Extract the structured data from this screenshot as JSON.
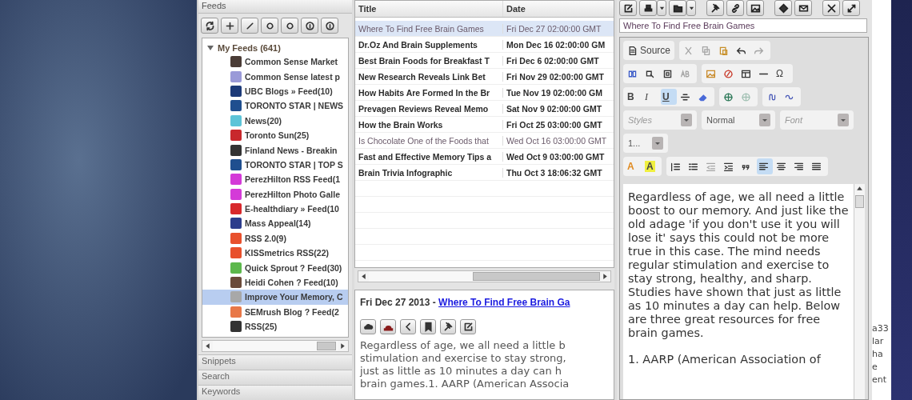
{
  "feeds_panel": {
    "title": "Feeds",
    "tree": [
      {
        "label": "My Feeds (641)",
        "expanded": true,
        "children": [
          {
            "label": "Common Sense Market",
            "color": "#4a3c36",
            "selected": false
          },
          {
            "label": "Common Sense latest p",
            "color": "#9a9ad8",
            "selected": false
          },
          {
            "label": "UBC Blogs » Feed(10)",
            "color": "#1c3a78",
            "selected": false
          },
          {
            "label": "TORONTO STAR | NEWS",
            "color": "#1f4f8f",
            "selected": false
          },
          {
            "label": "News(20)",
            "color": "#5cc4d8",
            "selected": false
          },
          {
            "label": "Toronto Sun(25)",
            "color": "#c8282c",
            "selected": false
          },
          {
            "label": "Finland News - Breakin",
            "color": "#333333",
            "selected": false
          },
          {
            "label": "TORONTO STAR | TOP S",
            "color": "#1f4f8f",
            "selected": false
          },
          {
            "label": "PerezHilton RSS Feed(1",
            "color": "#d43ad8",
            "selected": false
          },
          {
            "label": "PerezHilton Photo Galle",
            "color": "#d43ad8",
            "selected": false
          },
          {
            "label": "E-healthdiary » Feed(10",
            "color": "#d8282c",
            "selected": false
          },
          {
            "label": "Mass Appeal(14)",
            "color": "#2c3c8c",
            "selected": false
          },
          {
            "label": "RSS 2.0(9)",
            "color": "#e8502c",
            "selected": false
          },
          {
            "label": "KISSmetrics RSS(22)",
            "color": "#e8502c",
            "selected": false
          },
          {
            "label": "Quick Sprout ? Feed(30)",
            "color": "#5cb84c",
            "selected": false
          },
          {
            "label": "Heidi Cohen ? Feed(10)",
            "color": "#6a4a3a",
            "selected": false
          },
          {
            "label": "Improve Your Memory, C",
            "color": "#a8a8a8",
            "selected": true
          },
          {
            "label": "SEMrush Blog ? Feed(2",
            "color": "#e87848",
            "selected": false
          },
          {
            "label": "RSS(25)",
            "color": "#333333",
            "selected": false
          }
        ]
      }
    ],
    "sections": [
      "Snippets",
      "Search",
      "Keywords"
    ]
  },
  "articles": {
    "columns": [
      "Title",
      "Date"
    ],
    "rows": [
      {
        "title": "Where To Find Free Brain Games",
        "date": "Fri Dec 27 02:00:00 GMT",
        "unread": false,
        "selected": true
      },
      {
        "title": "Dr.Oz And Brain Supplements",
        "date": "Mon Dec 16 02:00:00 GM",
        "unread": true,
        "selected": false
      },
      {
        "title": "Best Brain Foods for Breakfast T",
        "date": "Fri Dec 6 02:00:00 GMT",
        "unread": true,
        "selected": false
      },
      {
        "title": "New Research Reveals Link Bet",
        "date": "Fri Nov 29 02:00:00 GMT",
        "unread": true,
        "selected": false
      },
      {
        "title": "How Habits Are Formed In the Br",
        "date": "Tue Nov 19 02:00:00 GM",
        "unread": true,
        "selected": false
      },
      {
        "title": "Prevagen Reviews Reveal Memo",
        "date": "Sat Nov 9 02:00:00 GMT",
        "unread": true,
        "selected": false
      },
      {
        "title": "How the Brain Works",
        "date": "Fri Oct 25 03:00:00 GMT",
        "unread": true,
        "selected": false
      },
      {
        "title": "Is Chocolate One of the Foods that",
        "date": "Wed Oct 16 03:00:00 GMT",
        "unread": false,
        "selected": false
      },
      {
        "title": "Fast and Effective Memory Tips a",
        "date": "Wed Oct 9 03:00:00 GMT",
        "unread": true,
        "selected": false
      },
      {
        "title": "Brain Trivia Infographic",
        "date": "Thu Oct 3 18:06:32 GMT",
        "unread": true,
        "selected": false
      }
    ]
  },
  "preview": {
    "date": "Fri Dec 27 2013 - ",
    "link": "Where To Find Free Brain Ga",
    "lines": [
      "Regardless of age, we all need a little b",
      "stimulation and exercise to stay strong,",
      "just as little as 10 minutes a day can h",
      "brain games.1. AARP (American Associa"
    ]
  },
  "composer": {
    "subject": "Where To Find Free Brain Games",
    "editor_toolbar": [
      [
        [
          {
            "kind": "button",
            "label": "Source",
            "on": false,
            "disabled": false
          }
        ],
        [
          {
            "kind": "button",
            "on": false,
            "disabled": true
          },
          {
            "kind": "button",
            "on": false,
            "disabled": true
          },
          {
            "kind": "button",
            "on": false,
            "disabled": false
          },
          {
            "kind": "button",
            "on": false,
            "disabled": false
          },
          {
            "kind": "button",
            "on": false,
            "disabled": true
          }
        ]
      ],
      [
        [
          {
            "kind": "button",
            "on": false,
            "disabled": false
          },
          {
            "kind": "button",
            "on": false,
            "disabled": false
          },
          {
            "kind": "button",
            "on": false,
            "disabled": false
          },
          {
            "kind": "button",
            "on": false,
            "disabled": true
          }
        ],
        [
          {
            "kind": "button",
            "on": false,
            "disabled": false
          },
          {
            "kind": "button",
            "on": false,
            "disabled": false
          },
          {
            "kind": "button",
            "on": false,
            "disabled": false
          },
          {
            "kind": "button",
            "on": false,
            "disabled": false
          },
          {
            "kind": "button",
            "label": "Ω",
            "on": false,
            "disabled": false
          }
        ]
      ],
      [
        [
          {
            "kind": "button",
            "label": "B",
            "on": false,
            "disabled": false
          },
          {
            "kind": "button",
            "label": "I",
            "on": false,
            "disabled": false
          },
          {
            "kind": "button",
            "label": "U",
            "on": true,
            "disabled": false
          },
          {
            "kind": "button",
            "on": false,
            "disabled": false
          },
          {
            "kind": "button",
            "on": false,
            "disabled": false
          }
        ],
        [
          {
            "kind": "button",
            "on": false,
            "disabled": false
          },
          {
            "kind": "button",
            "on": false,
            "disabled": true
          }
        ],
        [
          {
            "kind": "button",
            "on": false,
            "disabled": false
          },
          {
            "kind": "button",
            "on": false,
            "disabled": false
          }
        ]
      ],
      [
        [
          {
            "kind": "combo",
            "placeholder": "Styles"
          }
        ],
        [
          {
            "kind": "combo",
            "value": "Normal"
          }
        ],
        [
          {
            "kind": "combo",
            "placeholder": "Font"
          }
        ]
      ],
      [
        [
          {
            "kind": "combo",
            "value": "1..."
          }
        ]
      ],
      [
        [
          {
            "kind": "button",
            "label": "A",
            "on": false,
            "disabled": false
          },
          {
            "kind": "button",
            "label": "A",
            "on": false,
            "disabled": false
          }
        ],
        [
          {
            "kind": "button",
            "on": false,
            "disabled": false
          },
          {
            "kind": "button",
            "on": false,
            "disabled": false
          },
          {
            "kind": "button",
            "on": false,
            "disabled": true
          },
          {
            "kind": "button",
            "on": false,
            "disabled": false
          },
          {
            "kind": "button",
            "on": false,
            "disabled": false
          },
          {
            "kind": "button",
            "on": true,
            "disabled": false
          },
          {
            "kind": "button",
            "on": false,
            "disabled": false
          },
          {
            "kind": "button",
            "on": false,
            "disabled": false
          },
          {
            "kind": "button",
            "on": false,
            "disabled": false
          }
        ]
      ]
    ],
    "body": [
      "Regardless of age, we all need a little boost to our memory. And just like the old adage 'if you don't use it you will lose it' says this could not be more true in this case. The mind needs regular stimulation and exercise to stay strong, healthy, and sharp. Studies have shown that just as little as 10 minutes a day can help. Below are three great resources for free brain games.",
      "1. AARP (American Association of"
    ]
  },
  "background_fragments": [
    "a33",
    "lar",
    "ha",
    "e",
    "ent"
  ]
}
